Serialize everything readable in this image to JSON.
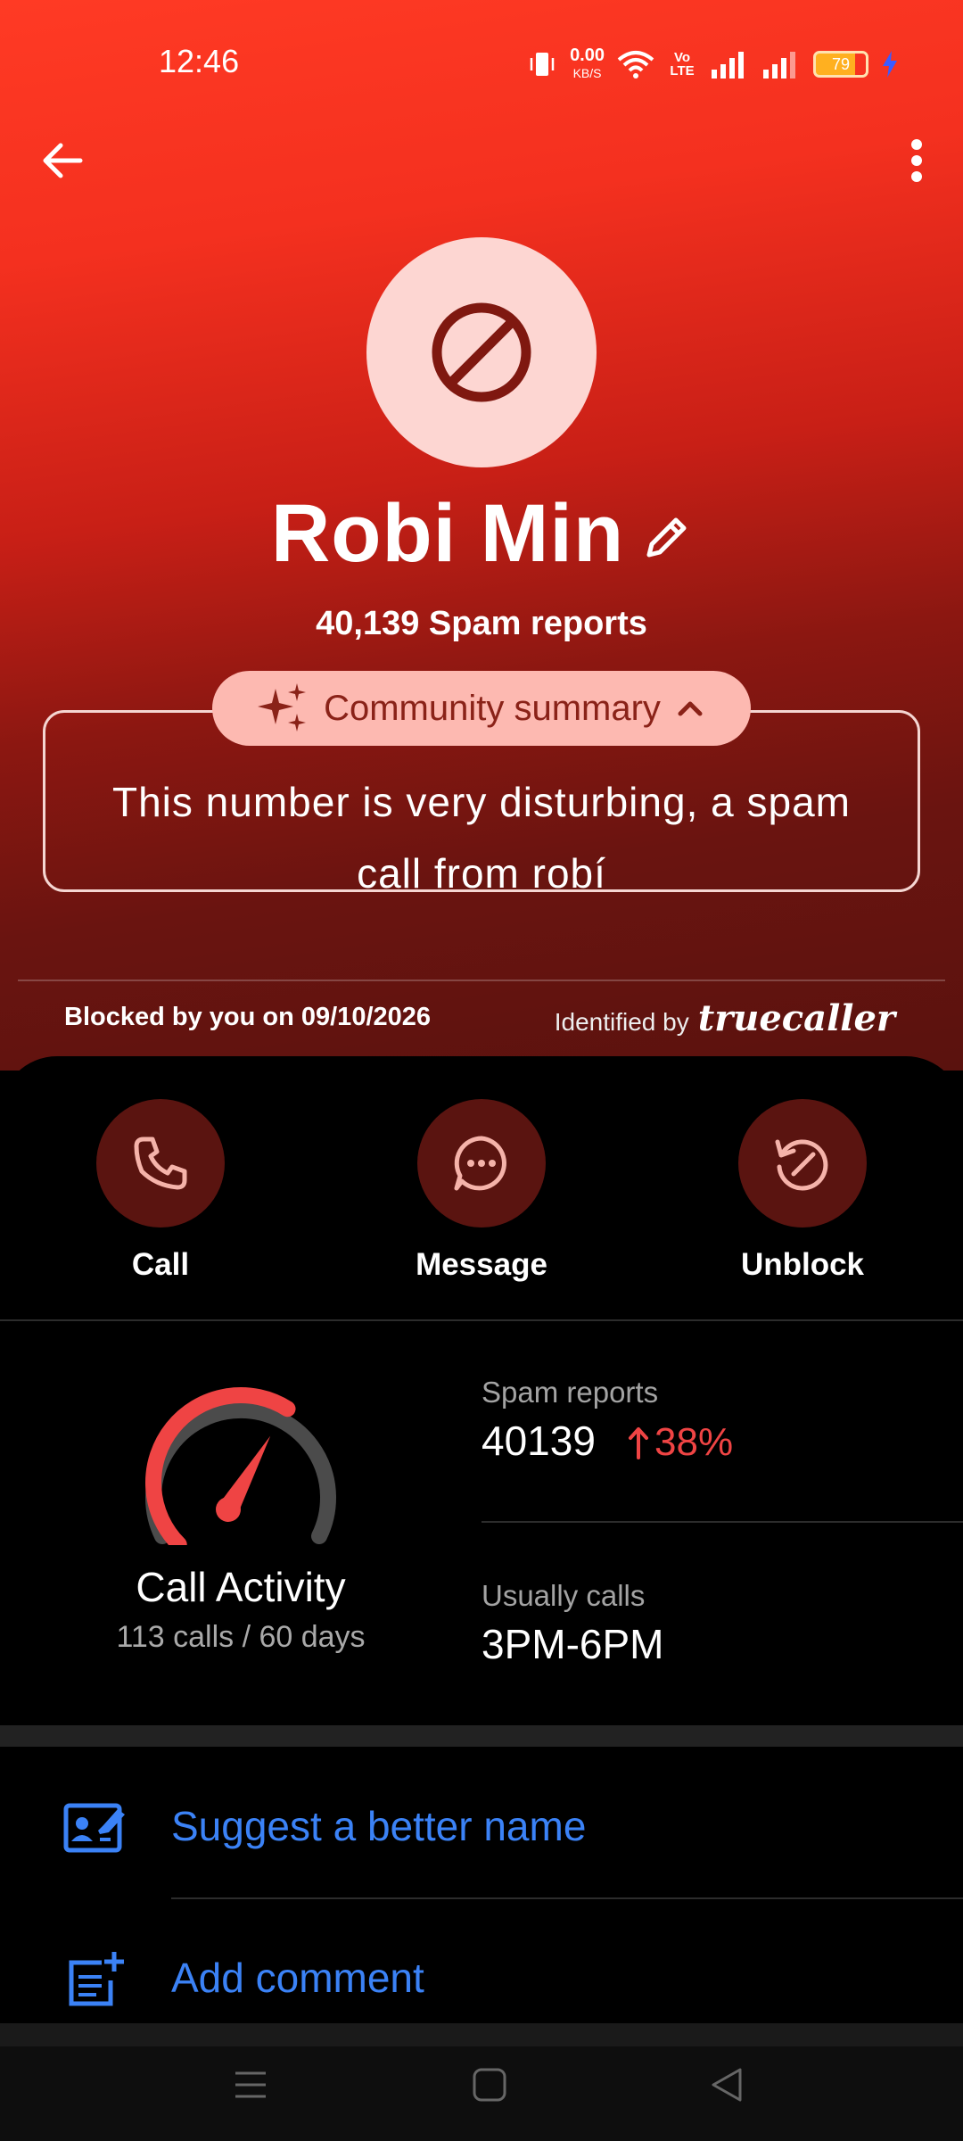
{
  "status": {
    "time": "12:46",
    "speed_value": "0.00",
    "speed_unit": "KB/S",
    "volte": "Vo LTE",
    "battery": "79"
  },
  "profile": {
    "name": "Robi Min",
    "spam_reports": "40,139 Spam reports"
  },
  "summary": {
    "chip_label": "Community summary",
    "text": "This number is very disturbing, a spam call from robí"
  },
  "meta": {
    "blocked": "Blocked by you on 09/10/2026",
    "identified_by": "Identified by",
    "brand": "truecaller"
  },
  "actions": [
    {
      "label": "Call"
    },
    {
      "label": "Message"
    },
    {
      "label": "Unblock"
    }
  ],
  "stats": {
    "call_activity_title": "Call Activity",
    "call_activity_sub": "113 calls / 60 days",
    "spam_label": "Spam reports",
    "spam_value": "40139",
    "spam_trend": "38%",
    "usually_label": "Usually calls",
    "usually_value": "3PM-6PM",
    "gauge_level": 0.62
  },
  "options": [
    {
      "label": "Suggest a better name"
    },
    {
      "label": "Add comment"
    }
  ],
  "colors": {
    "accent_red": "#ef4444",
    "link_blue": "#3b82f6",
    "action_circle": "#5a1410"
  }
}
